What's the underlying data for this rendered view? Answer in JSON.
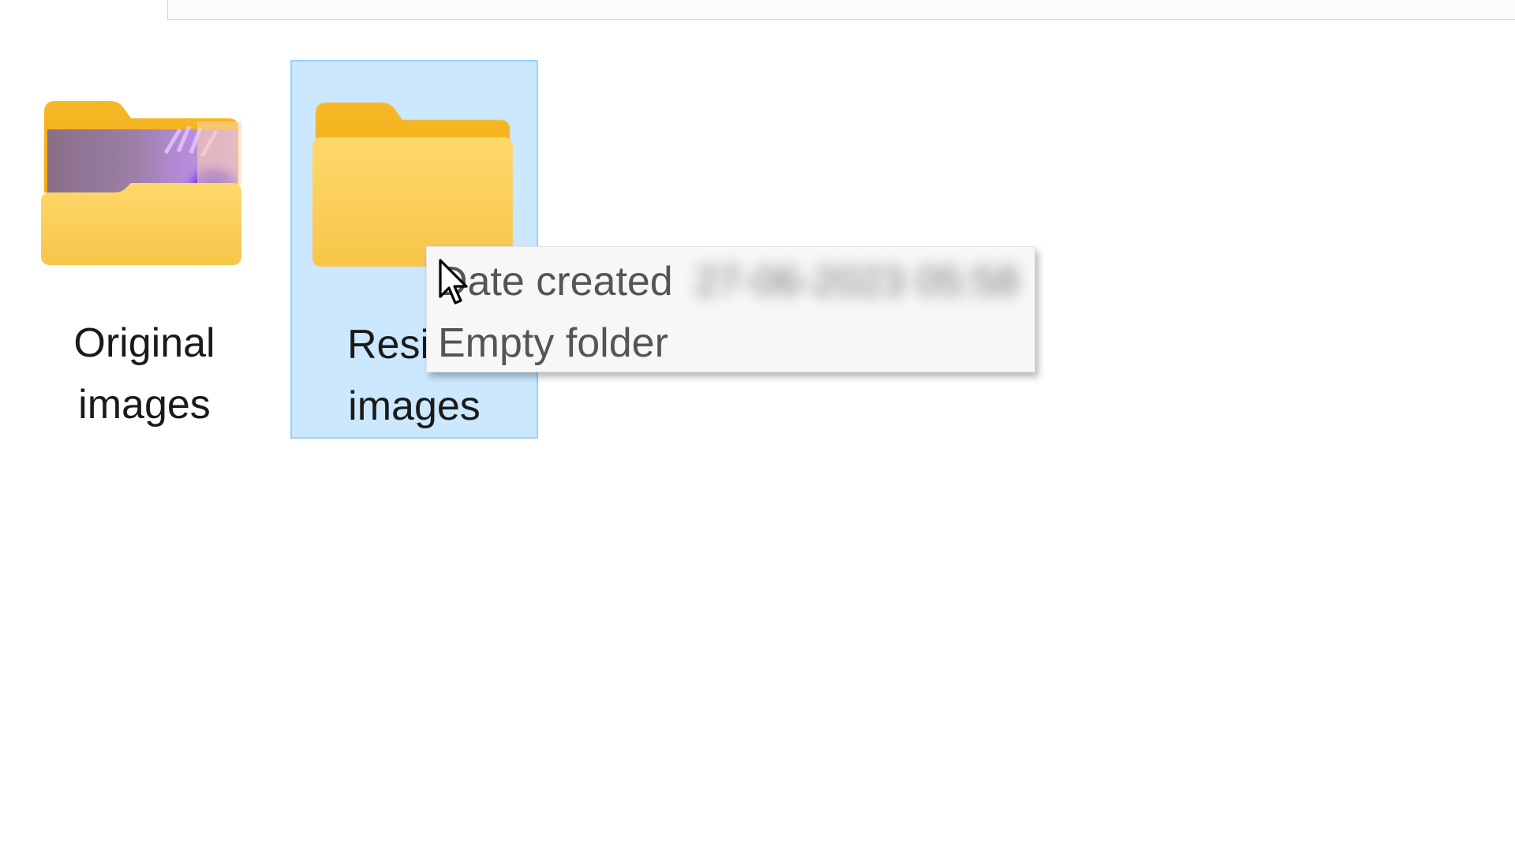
{
  "folders": [
    {
      "name": "Original images",
      "line1": "Original",
      "line2": "images",
      "thumbnail": "photo-preview-purple-flower",
      "selected": false
    },
    {
      "name": "Resized images",
      "line1": "Resiz",
      "line2": "images",
      "thumbnail": "empty",
      "selected": true
    }
  ],
  "tooltip": {
    "date_label": "Date created",
    "date_value": "27-06-2023 05:58",
    "status": "Empty folder"
  },
  "colors": {
    "selection_fill": "#cce8ff",
    "selection_border": "#99d1ff",
    "folder_yellow": "#f9cc54",
    "folder_tab": "#f4b521",
    "tooltip_bg": "#f7f7f7",
    "tooltip_text": "#555555"
  },
  "icons": {
    "folder": "folder-icon",
    "pointer": "mouse-pointer-icon"
  }
}
